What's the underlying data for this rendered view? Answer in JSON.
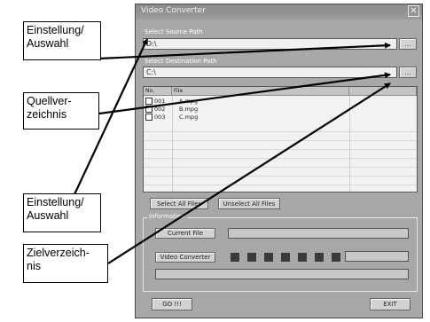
{
  "window": {
    "title": "Video Converter",
    "close_glyph": "✕",
    "source": {
      "label": "Select Source Path",
      "value": "D:\\",
      "browse_label": "..."
    },
    "destination": {
      "label": "Select Destination Path",
      "value": "C:\\",
      "browse_label": "..."
    },
    "table": {
      "columns": [
        "No.",
        "File"
      ],
      "rows": [
        {
          "no": "001",
          "file": "A.mpg"
        },
        {
          "no": "002",
          "file": "B.mpg"
        },
        {
          "no": "003",
          "file": "C.mpg"
        }
      ]
    },
    "select_all_label": "Select All Files",
    "unselect_all_label": "Unselect All Files",
    "info": {
      "title": "Information",
      "current_file_label": "Current File",
      "converter_label": "Video Converter"
    },
    "go_label": "GO !!!",
    "exit_label": "EXIT"
  },
  "annotations": [
    {
      "text": "Einstellung/ Auswahl"
    },
    {
      "text": "Quellver- zeichnis"
    },
    {
      "text": "Einstellung/ Auswahl"
    },
    {
      "text": "Zielverzeich- nis"
    }
  ]
}
